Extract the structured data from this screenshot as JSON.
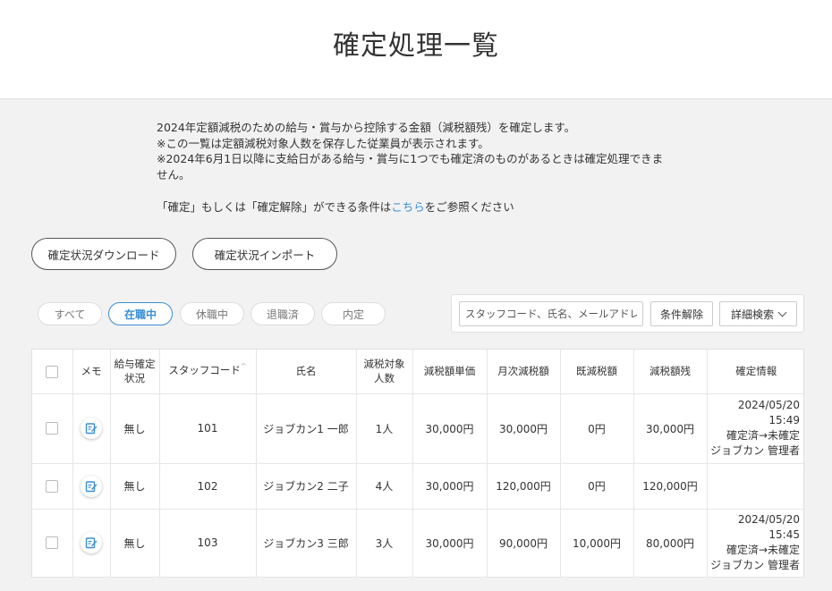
{
  "header": {
    "title": "確定処理一覧"
  },
  "description": {
    "lines": [
      "2024年定額減税のための給与・賞与から控除する金額（減税額残）を確定します。",
      "※この一覧は定額減税対象人数を保存した従業員が表示されます。",
      "※2024年6月1日以降に支給日がある給与・賞与に1つでも確定済のものがあるときは確定処理できま",
      "せん。"
    ],
    "ref_prefix": "「確定」もしくは「確定解除」ができる条件は",
    "ref_link": "こちら",
    "ref_suffix": "をご参照ください"
  },
  "actions": {
    "download": "確定状況ダウンロード",
    "import": "確定状況インポート"
  },
  "filters": {
    "items": [
      "すべて",
      "在職中",
      "休職中",
      "退職済",
      "内定"
    ],
    "active_index": 1
  },
  "search": {
    "placeholder": "スタッフコード、氏名、メールアドレス",
    "clear": "条件解除",
    "advanced": "詳細検索"
  },
  "table": {
    "headers": {
      "memo": "メモ",
      "salary_status_1": "給与確定",
      "salary_status_2": "状況",
      "staff_code": "スタッフコード",
      "sort_mark": "^",
      "name": "氏名",
      "count_1": "減税対象",
      "count_2": "人数",
      "unit": "減税額単価",
      "monthly": "月次減税額",
      "existing": "既減税額",
      "remaining": "減税額残",
      "info": "確定情報"
    },
    "rows": [
      {
        "status": "無し",
        "code": "101",
        "name": "ジョブカン1 一郎",
        "count": "1人",
        "unit": "30,000円",
        "monthly": "30,000円",
        "existing": "0円",
        "remaining": "30,000円",
        "info_date": "2024/05/20 15:49",
        "info_change": "確定済→未確定",
        "info_user": "ジョブカン 管理者"
      },
      {
        "status": "無し",
        "code": "102",
        "name": "ジョブカン2 二子",
        "count": "4人",
        "unit": "30,000円",
        "monthly": "120,000円",
        "existing": "0円",
        "remaining": "120,000円",
        "info_date": "",
        "info_change": "",
        "info_user": ""
      },
      {
        "status": "無し",
        "code": "103",
        "name": "ジョブカン3 三郎",
        "count": "3人",
        "unit": "30,000円",
        "monthly": "90,000円",
        "existing": "10,000円",
        "remaining": "80,000円",
        "info_date": "2024/05/20 15:45",
        "info_change": "確定済→未確定",
        "info_user": "ジョブカン 管理者"
      }
    ]
  },
  "colors": {
    "link": "#3a8fd6",
    "active_pill": "#3a8fd6",
    "memo_icon": "#3a8fd6"
  }
}
